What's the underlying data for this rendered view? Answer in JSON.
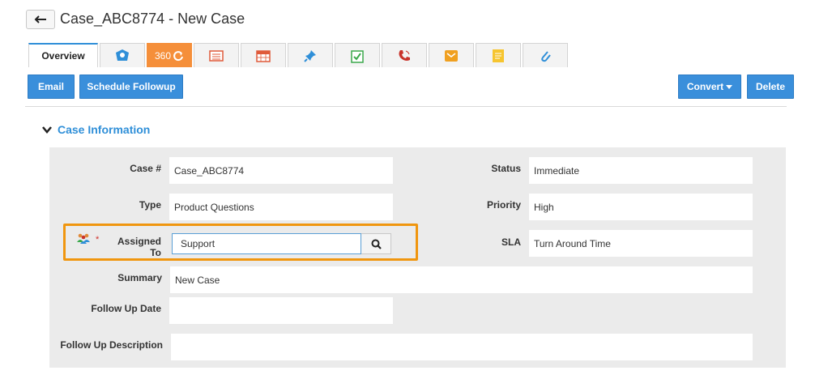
{
  "header": {
    "title": "Case_ABC8774 - New Case"
  },
  "tabs": {
    "overview_label": "Overview",
    "t360_label": "360",
    "icons": [
      "profile-icon",
      "360-icon",
      "list-icon",
      "calendar-icon",
      "pin-icon",
      "task-icon",
      "call-icon",
      "mail-icon",
      "note-icon",
      "attachment-icon"
    ]
  },
  "toolbar": {
    "email_label": "Email",
    "schedule_label": "Schedule Followup",
    "convert_label": "Convert",
    "delete_label": "Delete"
  },
  "section": {
    "title": "Case Information"
  },
  "form": {
    "case_label": "Case #",
    "case_value": "Case_ABC8774",
    "status_label": "Status",
    "status_value": "Immediate",
    "type_label": "Type",
    "type_value": "Product Questions",
    "priority_label": "Priority",
    "priority_value": "High",
    "assigned_label": "Assigned To",
    "assigned_value": "Support",
    "required_mark": "*",
    "sla_label": "SLA",
    "sla_value": "Turn Around Time",
    "summary_label": "Summary",
    "summary_value": "New Case",
    "followup_date_label": "Follow Up Date",
    "followup_date_value": "",
    "followup_desc_label": "Follow Up Description",
    "followup_desc_value": ""
  },
  "colors": {
    "accent": "#3a8fdb",
    "highlight": "#f0960f",
    "tab360": "#f58f3a"
  }
}
